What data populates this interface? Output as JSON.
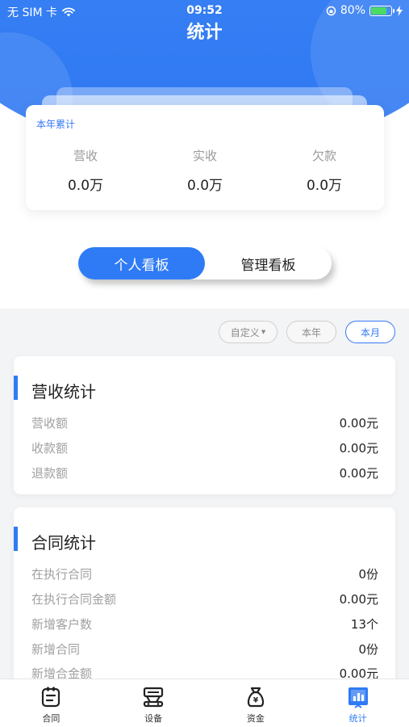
{
  "status_bar": {
    "carrier": "无 SIM 卡",
    "time": "09:52",
    "battery_percent": "80%",
    "battery_level": 0.8
  },
  "header": {
    "title": "统计"
  },
  "summary": {
    "title": "本年累计",
    "items": [
      {
        "label": "营收",
        "value": "0.0万"
      },
      {
        "label": "实收",
        "value": "0.0万"
      },
      {
        "label": "欠款",
        "value": "0.0万"
      }
    ]
  },
  "board_toggle": {
    "options": [
      "个人看板",
      "管理看板"
    ],
    "selected": "个人看板"
  },
  "filters": {
    "custom": "自定义",
    "year": "本年",
    "month": "本月",
    "selected": "本月"
  },
  "revenue_card": {
    "title": "营收统计",
    "rows": [
      {
        "label": "营收额",
        "value": "0.00元"
      },
      {
        "label": "收款额",
        "value": "0.00元"
      },
      {
        "label": "退款额",
        "value": "0.00元"
      }
    ]
  },
  "contract_card": {
    "title": "合同统计",
    "rows": [
      {
        "label": "在执行合同",
        "value": "0份"
      },
      {
        "label": "在执行合同金额",
        "value": "0.00元"
      },
      {
        "label": "新增客户数",
        "value": "13个"
      },
      {
        "label": "新增合同",
        "value": "0份"
      },
      {
        "label": "新增合金额",
        "value": "0.00元"
      }
    ]
  },
  "tabbar": {
    "items": [
      {
        "label": "合同",
        "icon": "contract-icon"
      },
      {
        "label": "设备",
        "icon": "device-icon"
      },
      {
        "label": "资金",
        "icon": "money-bag-icon"
      },
      {
        "label": "统计",
        "icon": "statistics-icon"
      }
    ],
    "active": "统计"
  },
  "colors": {
    "primary": "#2f7bf5",
    "background": "#f3f4f6",
    "battery_green": "#4cd964"
  }
}
